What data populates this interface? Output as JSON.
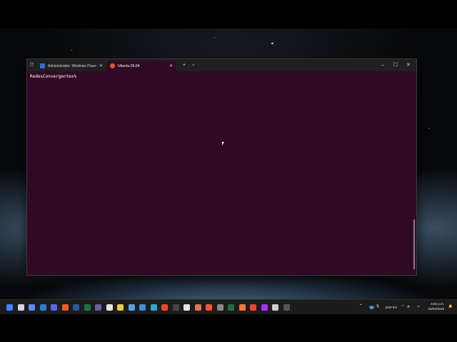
{
  "window": {
    "tabs": [
      {
        "label": "Administrador: Windows Powe",
        "icon": "powershell-icon"
      },
      {
        "label": "Ubuntu-26.04",
        "icon": "ubuntu-icon"
      }
    ],
    "new_tab_label": "+",
    "dropdown_label": "⌄",
    "minimize": "–",
    "maximize": "☐",
    "close": "✕"
  },
  "terminal": {
    "prompt": "RedesConvergentes%",
    "background": "#300a24"
  },
  "taskbar": {
    "language": "ESP ES",
    "time": "4:02 p.m.",
    "date": "23/03/2026",
    "apps": [
      "start",
      "search",
      "copilot",
      "vscode",
      "discord",
      "brave",
      "word",
      "excel",
      "teams",
      "github",
      "files",
      "photos",
      "security",
      "edge",
      "gitbash",
      "terminal",
      "notion",
      "claude",
      "brave-alt",
      "store",
      "excel-alt",
      "firefox",
      "chrome",
      "messenger",
      "doc",
      "terminal-alt"
    ]
  }
}
